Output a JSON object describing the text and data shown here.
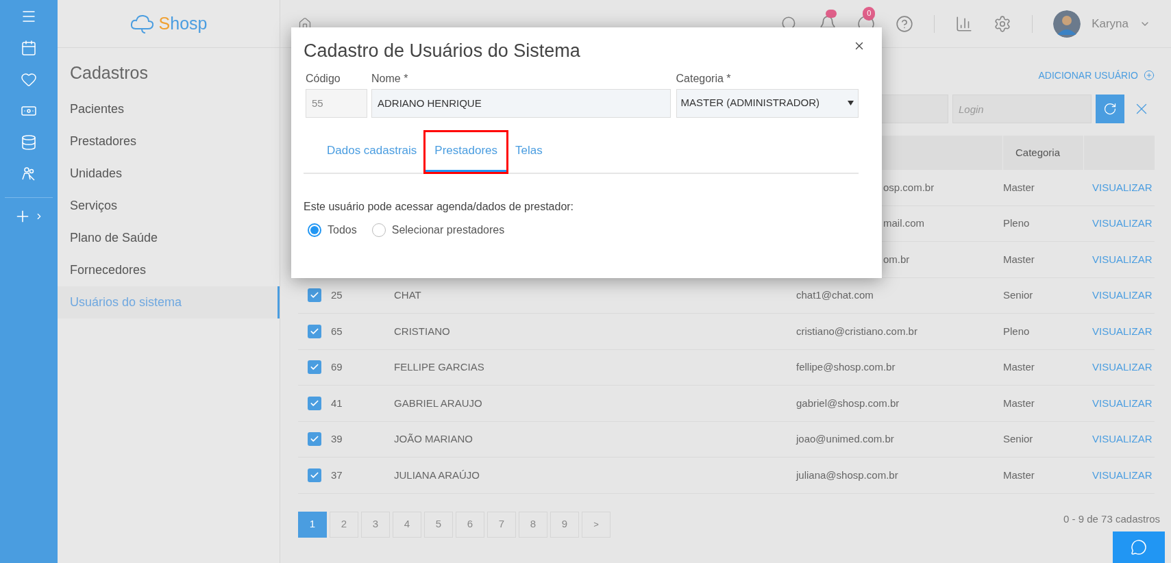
{
  "logo": {
    "initial": "S",
    "rest": "hosp"
  },
  "header": {
    "chat_badge": "0",
    "user": "Karyna"
  },
  "sidebar": {
    "title": "Cadastros",
    "items": [
      {
        "label": "Pacientes",
        "selected": false
      },
      {
        "label": "Prestadores",
        "selected": false
      },
      {
        "label": "Unidades",
        "selected": false
      },
      {
        "label": "Serviços",
        "selected": false
      },
      {
        "label": "Plano de Saúde",
        "selected": false
      },
      {
        "label": "Fornecedores",
        "selected": false
      },
      {
        "label": "Usuários do sistema",
        "selected": true
      }
    ]
  },
  "page": {
    "add_button": "ADICIONAR USUÁRIO",
    "login_placeholder": "Login"
  },
  "table": {
    "columns": [
      "Categoria"
    ],
    "rows": [
      {
        "covered": true,
        "email": "osp.com.br",
        "category": "Master",
        "action": "VISUALIZAR"
      },
      {
        "covered": true,
        "email": "mail.com",
        "category": "Pleno",
        "action": "VISUALIZAR"
      },
      {
        "covered": true,
        "email": "om.br",
        "category": "Master",
        "action": "VISUALIZAR"
      },
      {
        "covered": false,
        "checked": true,
        "code": "25",
        "name": "CHAT",
        "email": "chat1@chat.com",
        "category": "Senior",
        "action": "VISUALIZAR"
      },
      {
        "covered": false,
        "checked": true,
        "code": "65",
        "name": "CRISTIANO",
        "email": "cristiano@cristiano.com.br",
        "category": "Pleno",
        "action": "VISUALIZAR"
      },
      {
        "covered": false,
        "checked": true,
        "code": "69",
        "name": "FELLIPE GARCIAS",
        "email": "fellipe@shosp.com.br",
        "category": "Master",
        "action": "VISUALIZAR"
      },
      {
        "covered": false,
        "checked": true,
        "code": "41",
        "name": "GABRIEL ARAUJO",
        "email": "gabriel@shosp.com.br",
        "category": "Master",
        "action": "VISUALIZAR"
      },
      {
        "covered": false,
        "checked": true,
        "code": "39",
        "name": "JOÃO MARIANO",
        "email": "joao@unimed.com.br",
        "category": "Senior",
        "action": "VISUALIZAR"
      },
      {
        "covered": false,
        "checked": true,
        "code": "37",
        "name": "JULIANA ARAÚJO",
        "email": "juliana@shosp.com.br",
        "category": "Master",
        "action": "VISUALIZAR"
      }
    ]
  },
  "pagination": {
    "pages": [
      {
        "label": "1",
        "selected": true
      },
      {
        "label": "2",
        "selected": false
      },
      {
        "label": "3",
        "selected": false
      },
      {
        "label": "4",
        "selected": false
      },
      {
        "label": "5",
        "selected": false
      },
      {
        "label": "6",
        "selected": false
      },
      {
        "label": "7",
        "selected": false
      },
      {
        "label": "8",
        "selected": false
      },
      {
        "label": "9",
        "selected": false
      }
    ],
    "next": ">",
    "summary": "0 - 9 de 73 cadastros"
  },
  "modal": {
    "title": "Cadastro de Usuários do Sistema",
    "code": {
      "label": "Código",
      "value": "55"
    },
    "name": {
      "label": "Nome *",
      "value": "ADRIANO HENRIQUE"
    },
    "category": {
      "label": "Categoria *",
      "value": "MASTER (ADMINISTRADOR)"
    },
    "tabs": [
      {
        "label": "Dados cadastrais",
        "selected": false,
        "annotated": false
      },
      {
        "label": "Prestadores",
        "selected": true,
        "annotated": true
      },
      {
        "label": "Telas",
        "selected": false,
        "annotated": false
      }
    ],
    "prompt": "Este usuário pode acessar agenda/dados de prestador:",
    "options": [
      {
        "label": "Todos",
        "selected": true
      },
      {
        "label": "Selecionar prestadores",
        "selected": false
      }
    ]
  }
}
